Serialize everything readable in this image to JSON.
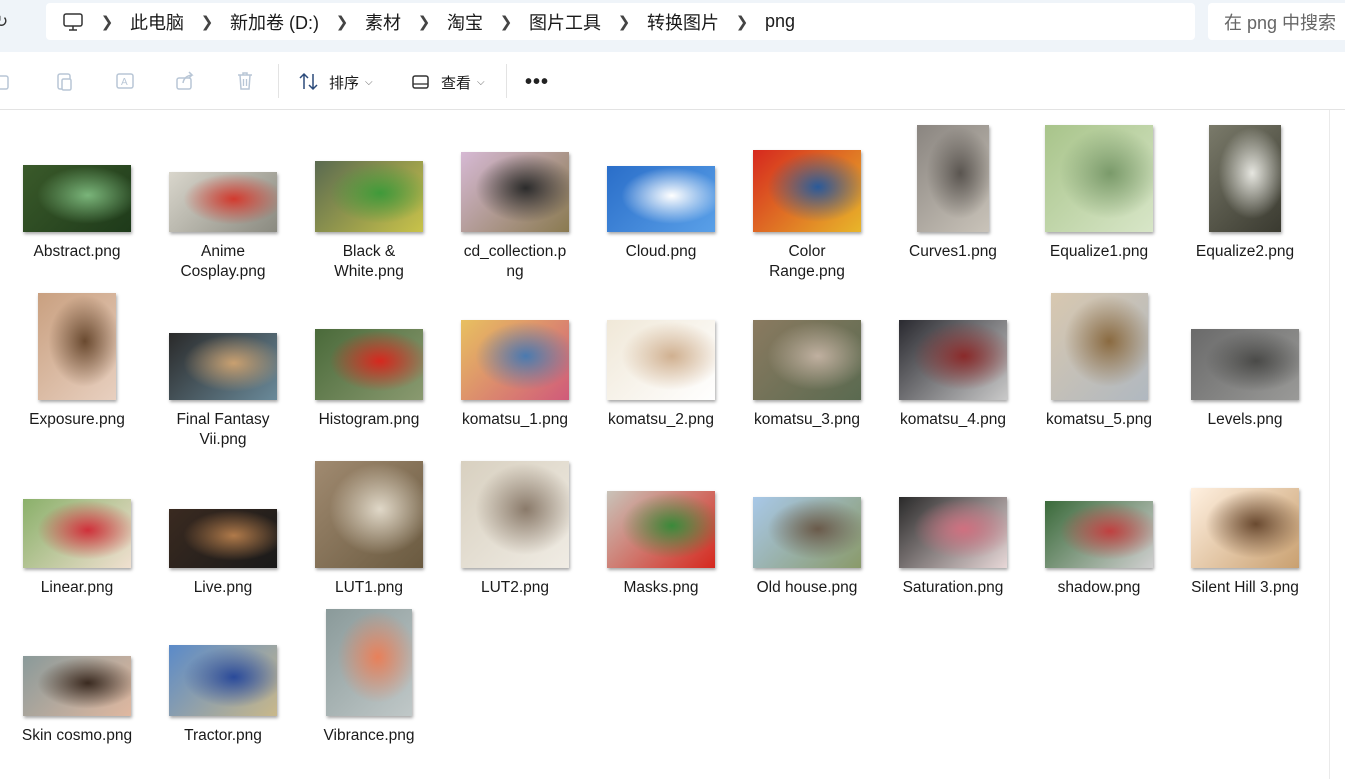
{
  "address_bar": {
    "breadcrumbs": [
      "此电脑",
      "新加卷 (D:)",
      "素材",
      "淘宝",
      "图片工具",
      "转换图片",
      "png"
    ],
    "search_placeholder": "在 png 中搜索"
  },
  "toolbar": {
    "sort_label": "排序",
    "view_label": "查看"
  },
  "files": [
    {
      "name": "Abstract.png",
      "colors": [
        "#3a5a2a",
        "#7ab57a",
        "#1e3a1a"
      ]
    },
    {
      "name": "Anime\nCosplay.png",
      "colors": [
        "#d9d6cc",
        "#d23a2e",
        "#8a8a80"
      ]
    },
    {
      "name": "Black &\nWhite.png",
      "colors": [
        "#5a6a50",
        "#3f9a3a",
        "#c9c34a"
      ]
    },
    {
      "name": "cd_collection.p\nng",
      "colors": [
        "#d6b9d4",
        "#2b2b2b",
        "#8a7a50"
      ]
    },
    {
      "name": "Cloud.png",
      "colors": [
        "#2a6ec9",
        "#ffffff",
        "#5aa0e8"
      ]
    },
    {
      "name": "Color\nRange.png",
      "colors": [
        "#d6281e",
        "#2a5a9a",
        "#e8b62a"
      ]
    },
    {
      "name": "Curves1.png",
      "colors": [
        "#8a8580",
        "#5a5550",
        "#c9c3b9"
      ]
    },
    {
      "name": "Equalize1.png",
      "colors": [
        "#a8c48a",
        "#7a9a6a",
        "#d8e6c8"
      ]
    },
    {
      "name": "Equalize2.png",
      "colors": [
        "#7a7a6a",
        "#e6e6e0",
        "#3a3a30"
      ]
    },
    {
      "name": "Exposure.png",
      "colors": [
        "#c9a080",
        "#6a4a30",
        "#e8d0c0"
      ]
    },
    {
      "name": "Final Fantasy\nVii.png",
      "colors": [
        "#2a2a2a",
        "#c9a070",
        "#6a8a9a"
      ]
    },
    {
      "name": "Histogram.png",
      "colors": [
        "#4a6a3a",
        "#d6281e",
        "#8a9a70"
      ]
    },
    {
      "name": "komatsu_1.png",
      "colors": [
        "#e8c060",
        "#4a7ab0",
        "#d05a7a"
      ]
    },
    {
      "name": "komatsu_2.png",
      "colors": [
        "#f0e8d8",
        "#d0b090",
        "#ffffff"
      ]
    },
    {
      "name": "komatsu_3.png",
      "colors": [
        "#8a7a60",
        "#c0b0a0",
        "#5a6a50"
      ]
    },
    {
      "name": "komatsu_4.png",
      "colors": [
        "#2a2a30",
        "#8a2a2a",
        "#c9c9c9"
      ]
    },
    {
      "name": "komatsu_5.png",
      "colors": [
        "#d8c8b0",
        "#8a6a40",
        "#b0b8c0"
      ]
    },
    {
      "name": "Levels.png",
      "colors": [
        "#6a6a6a",
        "#4a4a48",
        "#9a9a98"
      ]
    },
    {
      "name": "Linear.png",
      "colors": [
        "#8ab06a",
        "#d0303a",
        "#f0e0d0"
      ]
    },
    {
      "name": "Live.png",
      "colors": [
        "#3a2a20",
        "#b07a4a",
        "#1a1a1a"
      ]
    },
    {
      "name": "LUT1.png",
      "colors": [
        "#a08a70",
        "#e0d8c8",
        "#6a5a40"
      ]
    },
    {
      "name": "LUT2.png",
      "colors": [
        "#d8d0c0",
        "#8a7a6a",
        "#f0ece4"
      ]
    },
    {
      "name": "Masks.png",
      "colors": [
        "#c9c3b9",
        "#3a8a3a",
        "#d6281e"
      ]
    },
    {
      "name": "Old house.png",
      "colors": [
        "#a8c8e8",
        "#6a5a4a",
        "#8a9a6a"
      ]
    },
    {
      "name": "Saturation.png",
      "colors": [
        "#2a2a2a",
        "#d07080",
        "#e8d8d8"
      ]
    },
    {
      "name": "shadow.png",
      "colors": [
        "#3a6a3a",
        "#c04040",
        "#d0d0d0"
      ]
    },
    {
      "name": "Silent Hill 3.png",
      "colors": [
        "#fff0e0",
        "#6a4a30",
        "#c9a070"
      ]
    },
    {
      "name": "Skin cosmo.png",
      "colors": [
        "#8a9a9a",
        "#3a2a20",
        "#e0b8a0"
      ]
    },
    {
      "name": "Tractor.png",
      "colors": [
        "#5a8ac9",
        "#2a4a9a",
        "#c9b88a"
      ]
    },
    {
      "name": "Vibrance.png",
      "colors": [
        "#8a9a9a",
        "#e8805a",
        "#c0c8c8"
      ]
    }
  ]
}
